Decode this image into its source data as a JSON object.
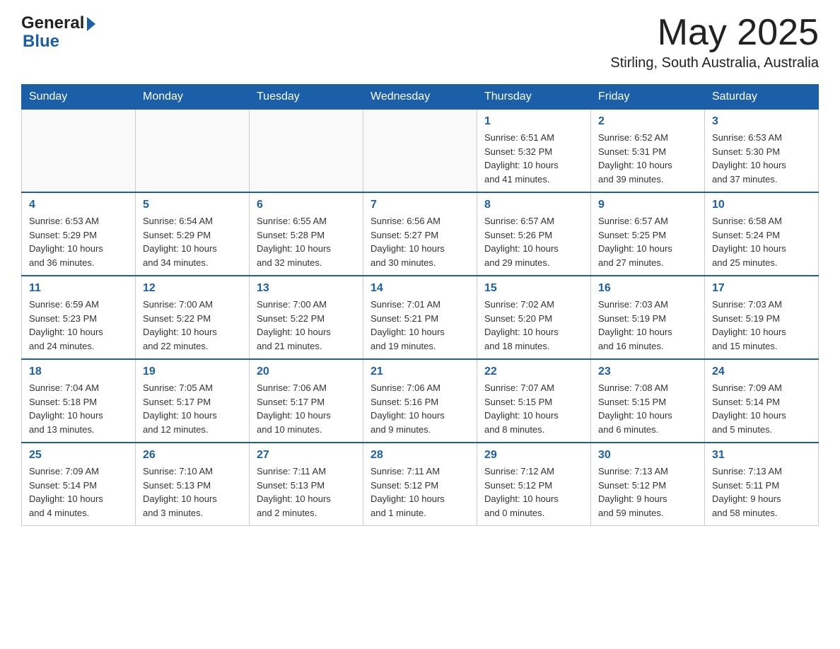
{
  "header": {
    "logo_general": "General",
    "logo_blue": "Blue",
    "month_year": "May 2025",
    "location": "Stirling, South Australia, Australia"
  },
  "days_of_week": [
    "Sunday",
    "Monday",
    "Tuesday",
    "Wednesday",
    "Thursday",
    "Friday",
    "Saturday"
  ],
  "weeks": [
    [
      {
        "day": "",
        "info": ""
      },
      {
        "day": "",
        "info": ""
      },
      {
        "day": "",
        "info": ""
      },
      {
        "day": "",
        "info": ""
      },
      {
        "day": "1",
        "info": "Sunrise: 6:51 AM\nSunset: 5:32 PM\nDaylight: 10 hours\nand 41 minutes."
      },
      {
        "day": "2",
        "info": "Sunrise: 6:52 AM\nSunset: 5:31 PM\nDaylight: 10 hours\nand 39 minutes."
      },
      {
        "day": "3",
        "info": "Sunrise: 6:53 AM\nSunset: 5:30 PM\nDaylight: 10 hours\nand 37 minutes."
      }
    ],
    [
      {
        "day": "4",
        "info": "Sunrise: 6:53 AM\nSunset: 5:29 PM\nDaylight: 10 hours\nand 36 minutes."
      },
      {
        "day": "5",
        "info": "Sunrise: 6:54 AM\nSunset: 5:29 PM\nDaylight: 10 hours\nand 34 minutes."
      },
      {
        "day": "6",
        "info": "Sunrise: 6:55 AM\nSunset: 5:28 PM\nDaylight: 10 hours\nand 32 minutes."
      },
      {
        "day": "7",
        "info": "Sunrise: 6:56 AM\nSunset: 5:27 PM\nDaylight: 10 hours\nand 30 minutes."
      },
      {
        "day": "8",
        "info": "Sunrise: 6:57 AM\nSunset: 5:26 PM\nDaylight: 10 hours\nand 29 minutes."
      },
      {
        "day": "9",
        "info": "Sunrise: 6:57 AM\nSunset: 5:25 PM\nDaylight: 10 hours\nand 27 minutes."
      },
      {
        "day": "10",
        "info": "Sunrise: 6:58 AM\nSunset: 5:24 PM\nDaylight: 10 hours\nand 25 minutes."
      }
    ],
    [
      {
        "day": "11",
        "info": "Sunrise: 6:59 AM\nSunset: 5:23 PM\nDaylight: 10 hours\nand 24 minutes."
      },
      {
        "day": "12",
        "info": "Sunrise: 7:00 AM\nSunset: 5:22 PM\nDaylight: 10 hours\nand 22 minutes."
      },
      {
        "day": "13",
        "info": "Sunrise: 7:00 AM\nSunset: 5:22 PM\nDaylight: 10 hours\nand 21 minutes."
      },
      {
        "day": "14",
        "info": "Sunrise: 7:01 AM\nSunset: 5:21 PM\nDaylight: 10 hours\nand 19 minutes."
      },
      {
        "day": "15",
        "info": "Sunrise: 7:02 AM\nSunset: 5:20 PM\nDaylight: 10 hours\nand 18 minutes."
      },
      {
        "day": "16",
        "info": "Sunrise: 7:03 AM\nSunset: 5:19 PM\nDaylight: 10 hours\nand 16 minutes."
      },
      {
        "day": "17",
        "info": "Sunrise: 7:03 AM\nSunset: 5:19 PM\nDaylight: 10 hours\nand 15 minutes."
      }
    ],
    [
      {
        "day": "18",
        "info": "Sunrise: 7:04 AM\nSunset: 5:18 PM\nDaylight: 10 hours\nand 13 minutes."
      },
      {
        "day": "19",
        "info": "Sunrise: 7:05 AM\nSunset: 5:17 PM\nDaylight: 10 hours\nand 12 minutes."
      },
      {
        "day": "20",
        "info": "Sunrise: 7:06 AM\nSunset: 5:17 PM\nDaylight: 10 hours\nand 10 minutes."
      },
      {
        "day": "21",
        "info": "Sunrise: 7:06 AM\nSunset: 5:16 PM\nDaylight: 10 hours\nand 9 minutes."
      },
      {
        "day": "22",
        "info": "Sunrise: 7:07 AM\nSunset: 5:15 PM\nDaylight: 10 hours\nand 8 minutes."
      },
      {
        "day": "23",
        "info": "Sunrise: 7:08 AM\nSunset: 5:15 PM\nDaylight: 10 hours\nand 6 minutes."
      },
      {
        "day": "24",
        "info": "Sunrise: 7:09 AM\nSunset: 5:14 PM\nDaylight: 10 hours\nand 5 minutes."
      }
    ],
    [
      {
        "day": "25",
        "info": "Sunrise: 7:09 AM\nSunset: 5:14 PM\nDaylight: 10 hours\nand 4 minutes."
      },
      {
        "day": "26",
        "info": "Sunrise: 7:10 AM\nSunset: 5:13 PM\nDaylight: 10 hours\nand 3 minutes."
      },
      {
        "day": "27",
        "info": "Sunrise: 7:11 AM\nSunset: 5:13 PM\nDaylight: 10 hours\nand 2 minutes."
      },
      {
        "day": "28",
        "info": "Sunrise: 7:11 AM\nSunset: 5:12 PM\nDaylight: 10 hours\nand 1 minute."
      },
      {
        "day": "29",
        "info": "Sunrise: 7:12 AM\nSunset: 5:12 PM\nDaylight: 10 hours\nand 0 minutes."
      },
      {
        "day": "30",
        "info": "Sunrise: 7:13 AM\nSunset: 5:12 PM\nDaylight: 9 hours\nand 59 minutes."
      },
      {
        "day": "31",
        "info": "Sunrise: 7:13 AM\nSunset: 5:11 PM\nDaylight: 9 hours\nand 58 minutes."
      }
    ]
  ]
}
